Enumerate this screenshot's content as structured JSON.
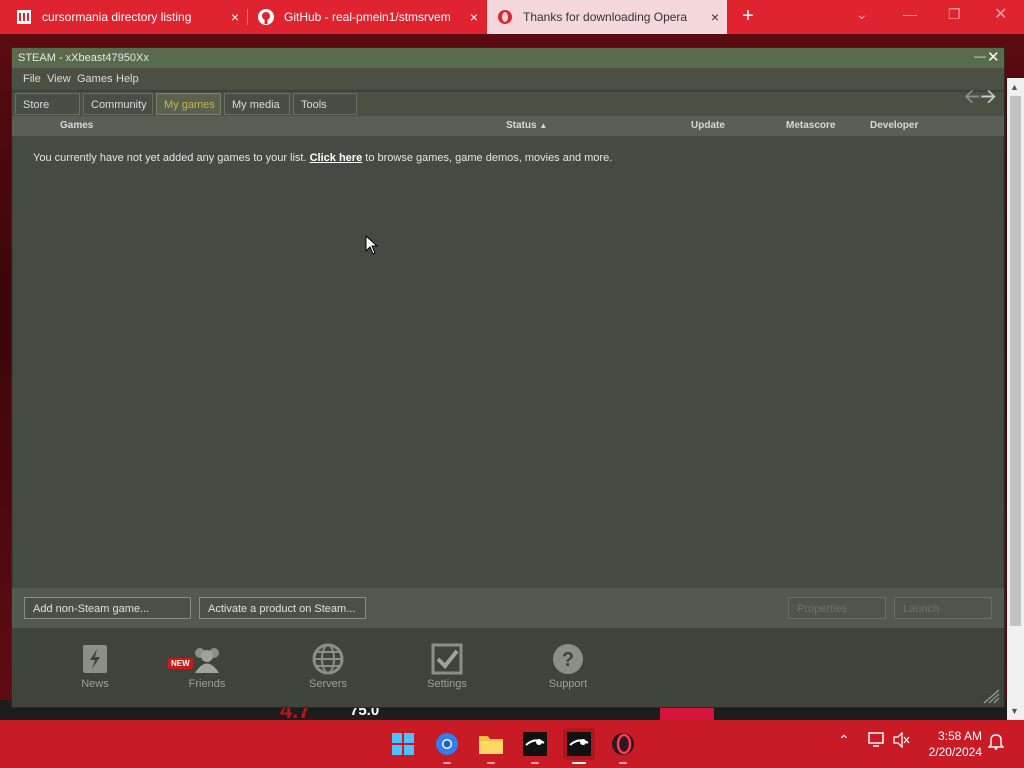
{
  "browser": {
    "tabs": [
      {
        "title": "cursormania directory listing",
        "active": false
      },
      {
        "title": "GitHub - real-pmein1/stmsrvem",
        "active": false
      },
      {
        "title": "Thanks for downloading Opera",
        "active": true
      }
    ],
    "new_tab": "+",
    "close": "×"
  },
  "background_page": {
    "score": "75.0",
    "big_text": "4.7"
  },
  "steam": {
    "window_title": "STEAM - xXbeast47950Xx",
    "menu": [
      "File",
      "View",
      "Games",
      "Help"
    ],
    "tabs": [
      "Store",
      "Community",
      "My games",
      "My media",
      "Tools"
    ],
    "active_tab": "My games",
    "columns": {
      "games": "Games",
      "status": "Status",
      "update": "Update",
      "metascore": "Metascore",
      "developer": "Developer"
    },
    "empty_message_pre": "You currently have not yet added any games to your list.",
    "empty_message_link": "Click here",
    "empty_message_post": "to browse games, game demos, movies and more.",
    "buttons": {
      "add_non_steam": "Add non-Steam game...",
      "activate_product": "Activate a product on Steam...",
      "properties": "Properties",
      "launch": "Launch"
    },
    "bottom_icons": [
      {
        "label": "News",
        "icon": "news-icon"
      },
      {
        "label": "Friends",
        "icon": "friends-icon",
        "badge": "NEW"
      },
      {
        "label": "Servers",
        "icon": "globe-icon"
      },
      {
        "label": "Settings",
        "icon": "checkbox-icon"
      },
      {
        "label": "Support",
        "icon": "question-icon"
      }
    ]
  },
  "taskbar": {
    "time": "3:58 AM",
    "date": "2/20/2024"
  },
  "colors": {
    "browser_red": "#e0242f",
    "taskbar_red": "#c81b26",
    "steam_bg": "#3e4139",
    "active_tab_text": "#c4b550"
  }
}
